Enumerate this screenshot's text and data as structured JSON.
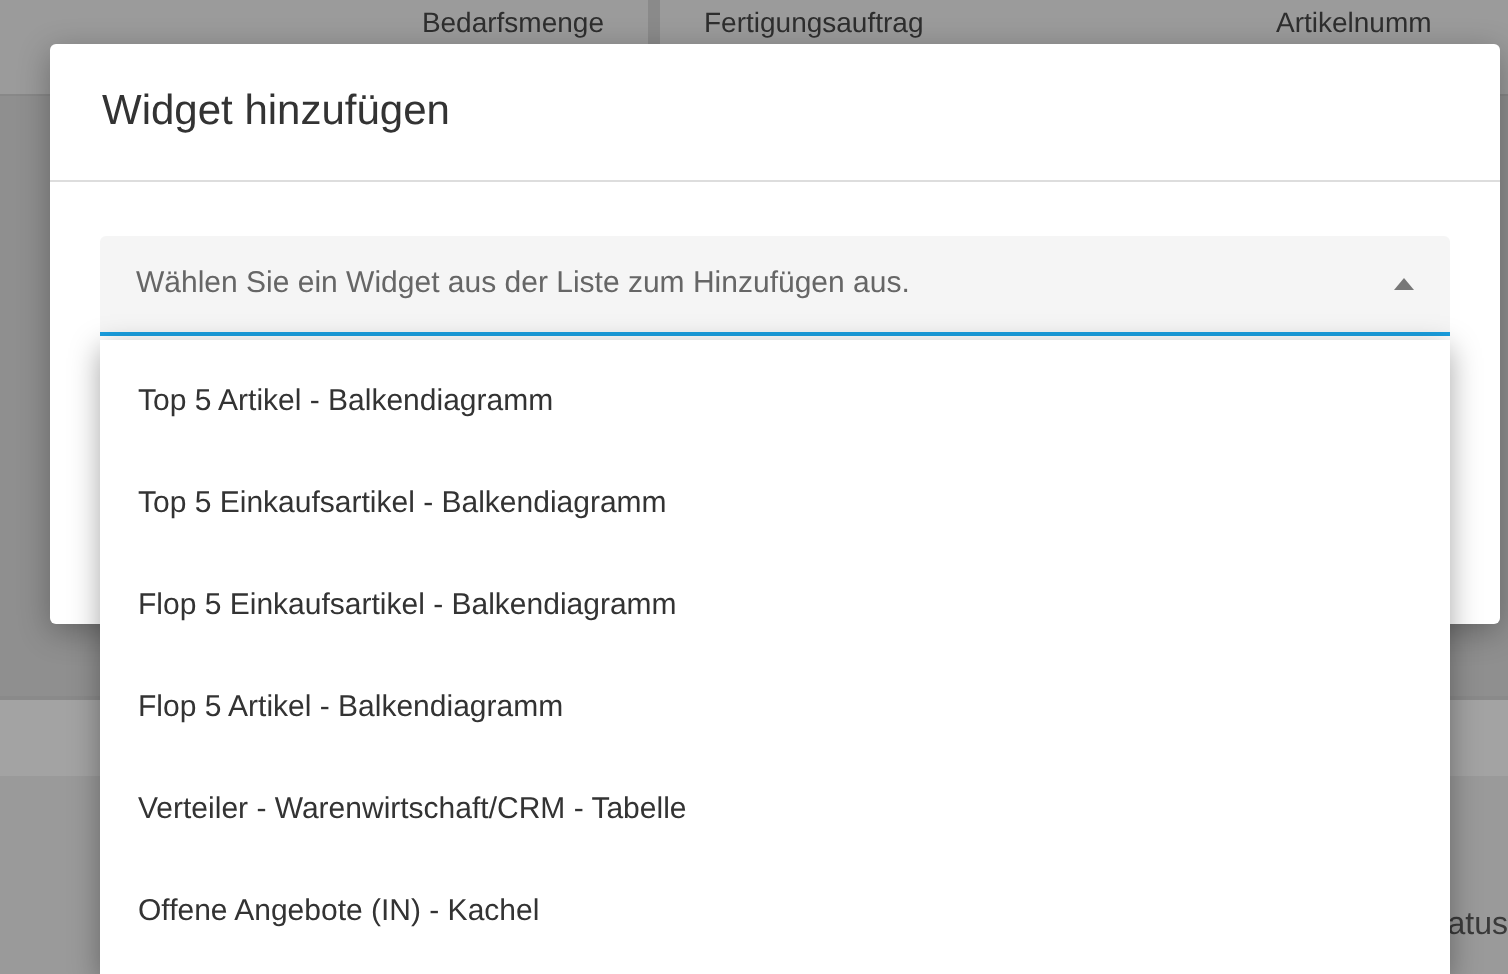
{
  "background": {
    "columns": [
      "Bedarfsmenge",
      "Fertigungsauftrag",
      "Artikelnumm"
    ],
    "status_fragment": "atus"
  },
  "dialog": {
    "title": "Widget hinzufügen",
    "select": {
      "placeholder": "Wählen Sie ein Widget aus der Liste zum Hinzufügen aus.",
      "expanded": true
    },
    "options": [
      {
        "label": "Top 5 Artikel - Balkendiagramm",
        "selected": false
      },
      {
        "label": "Top 5 Einkaufsartikel - Balkendiagramm",
        "selected": false
      },
      {
        "label": "Flop 5 Einkaufsartikel - Balkendiagramm",
        "selected": false
      },
      {
        "label": "Flop 5 Artikel - Balkendiagramm",
        "selected": false
      },
      {
        "label": "Verteiler - Warenwirtschaft/CRM - Tabelle",
        "selected": false
      },
      {
        "label": "Offene Angebote (IN) - Kachel",
        "selected": false
      }
    ]
  }
}
